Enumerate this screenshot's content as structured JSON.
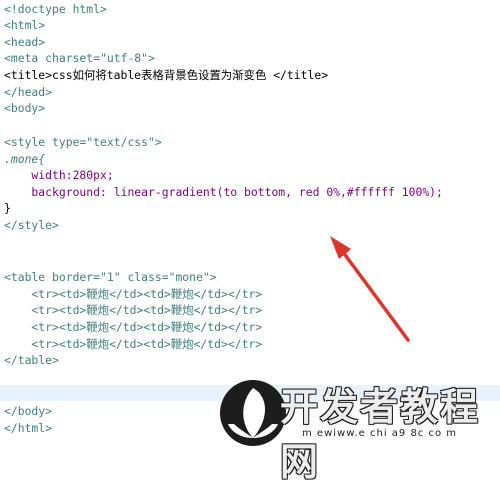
{
  "editor": {
    "lines": [
      "<!doctype html>",
      "<html>",
      "<head>",
      "<meta charset=\"utf-8\">",
      "<title>css如何将table表格背景色设置为渐变色 </title>",
      "</head>",
      "<body>",
      "",
      "<style type=\"text/css\">",
      ".mone{",
      "    width:280px;",
      "    background: linear-gradient(to bottom, red 0%,#ffffff 100%);",
      "}",
      "</style>",
      "",
      "",
      "<table border=\"1\" class=\"mone\">",
      "    <tr><td>鞭炮</td><td>鞭炮</td></tr>",
      "    <tr><td>鞭炮</td><td>鞭炮</td></tr>",
      "    <tr><td>鞭炮</td><td>鞭炮</td></tr>",
      "    <tr><td>鞭炮</td><td>鞭炮</td></tr>",
      "</table>",
      "",
      "",
      "</body>",
      "</html>"
    ]
  },
  "colors": {
    "tag": "#3f7f7f",
    "attribute": "#7f007f",
    "value": "#2a00ff",
    "current_line": "#e8f2fe",
    "arrow": "#d9362e"
  },
  "watermark": {
    "title": "开发者教程网",
    "url": "m ewiww.e chi a9 8c co m"
  }
}
